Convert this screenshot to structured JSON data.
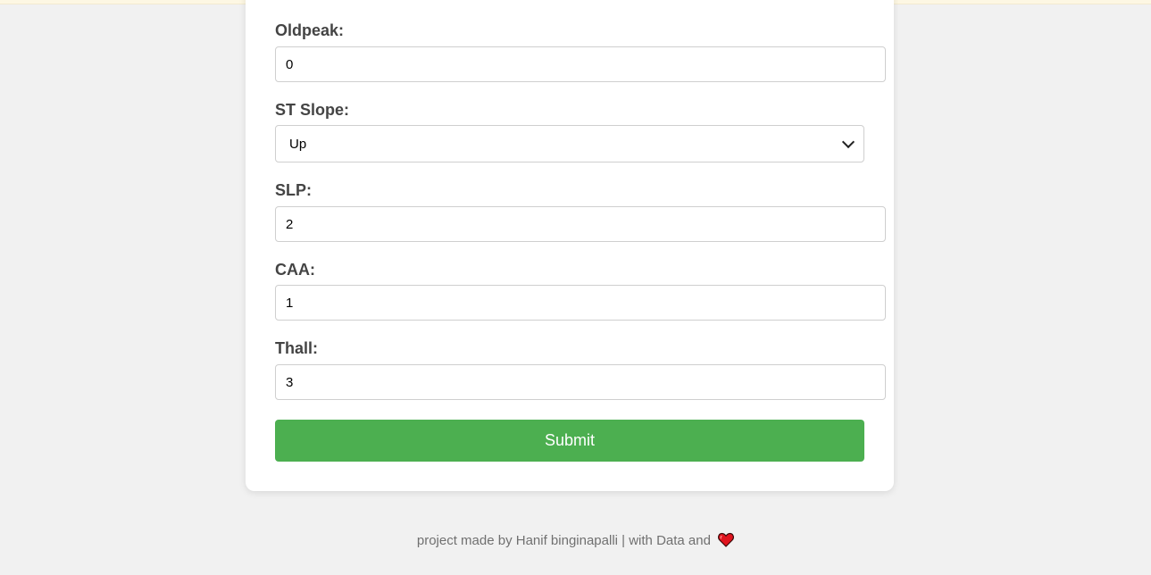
{
  "form": {
    "fields": [
      {
        "label": "Oldpeak:",
        "value": "0"
      },
      {
        "label": "ST Slope:",
        "value": "Up"
      },
      {
        "label": "SLP:",
        "value": "2"
      },
      {
        "label": "CAA:",
        "value": "1"
      },
      {
        "label": "Thall:",
        "value": "3"
      }
    ],
    "submit_label": "Submit"
  },
  "footer": {
    "text": "project made by Hanif binginapalli | with Data and",
    "icon": "heart-icon"
  },
  "colors": {
    "submit": "#4caf50",
    "heart": "#e0141e",
    "background": "#f1f1f1",
    "card": "#ffffff"
  }
}
